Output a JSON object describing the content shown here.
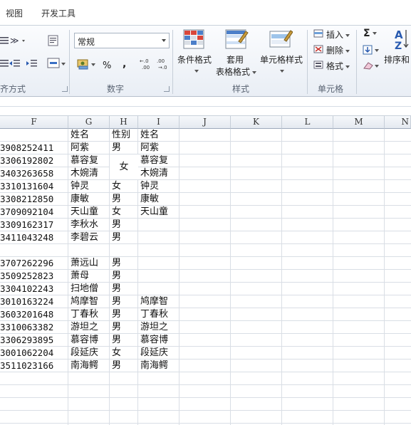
{
  "menubar": {
    "tabs": [
      {
        "label": "视图"
      },
      {
        "label": "开发工具"
      }
    ]
  },
  "ribbon": {
    "alignment": {
      "group_label": "齐方式"
    },
    "number": {
      "format_value": "常规",
      "percent_symbol": "%",
      "comma_symbol": ",",
      "increase_decimal": "←.0 .00",
      "decrease_decimal": ".00 →.0",
      "group_label": "数字"
    },
    "styles": {
      "conditional_format_line1": "条件格式",
      "table_format_line1": "套用",
      "table_format_line2": "表格格式",
      "cell_styles": "单元格样式",
      "group_label": "样式"
    },
    "cells": {
      "insert": "插入",
      "delete": "删除",
      "format": "格式",
      "group_label": "单元格"
    },
    "editing": {
      "sort_filter": "排序和"
    }
  },
  "grid": {
    "columns": [
      "F",
      "G",
      "H",
      "I",
      "J",
      "K",
      "L",
      "M",
      "N"
    ],
    "headers": {
      "G": "姓名",
      "H": "性别",
      "I": "姓名"
    },
    "rows": [
      {
        "F": "3908252411",
        "G": "阿紫",
        "H": "男",
        "I": "阿紫"
      },
      {
        "F": "3306192802",
        "G": "慕容复",
        "H": "",
        "I": "慕容复"
      },
      {
        "F": "3403263658",
        "G": "木婉清",
        "H": "",
        "I": "木婉清"
      },
      {
        "F": "3310131604",
        "G": "钟灵",
        "H": "女",
        "I": "钟灵"
      },
      {
        "F": "3308212850",
        "G": "康敏",
        "H": "男",
        "I": "康敏"
      },
      {
        "F": "3709092104",
        "G": "天山童",
        "H": "女",
        "I": "天山童"
      },
      {
        "F": "3309162317",
        "G": "李秋水",
        "H": "男",
        "I": ""
      },
      {
        "F": "3411043248",
        "G": "李碧云",
        "H": "男",
        "I": ""
      },
      {
        "F": "",
        "G": "",
        "H": "",
        "I": ""
      },
      {
        "F": "3707262296",
        "G": "萧远山",
        "H": "男",
        "I": ""
      },
      {
        "F": "3509252823",
        "G": "萧母",
        "H": "男",
        "I": ""
      },
      {
        "F": "3304102243",
        "G": "扫地僧",
        "H": "男",
        "I": ""
      },
      {
        "F": "3010163224",
        "G": "鸠摩智",
        "H": "男",
        "I": "鸠摩智"
      },
      {
        "F": "3603201648",
        "G": "丁春秋",
        "H": "男",
        "I": "丁春秋"
      },
      {
        "F": "3310063382",
        "G": "游坦之",
        "H": "男",
        "I": "游坦之"
      },
      {
        "F": "3306293895",
        "G": "慕容博",
        "H": "男",
        "I": "慕容博"
      },
      {
        "F": "3001062204",
        "G": "段延庆",
        "H": "女",
        "I": "段延庆"
      },
      {
        "F": "3511023166",
        "G": "南海鳄",
        "H": "男",
        "I": "南海鳄"
      }
    ],
    "merged_h_value": "女"
  }
}
